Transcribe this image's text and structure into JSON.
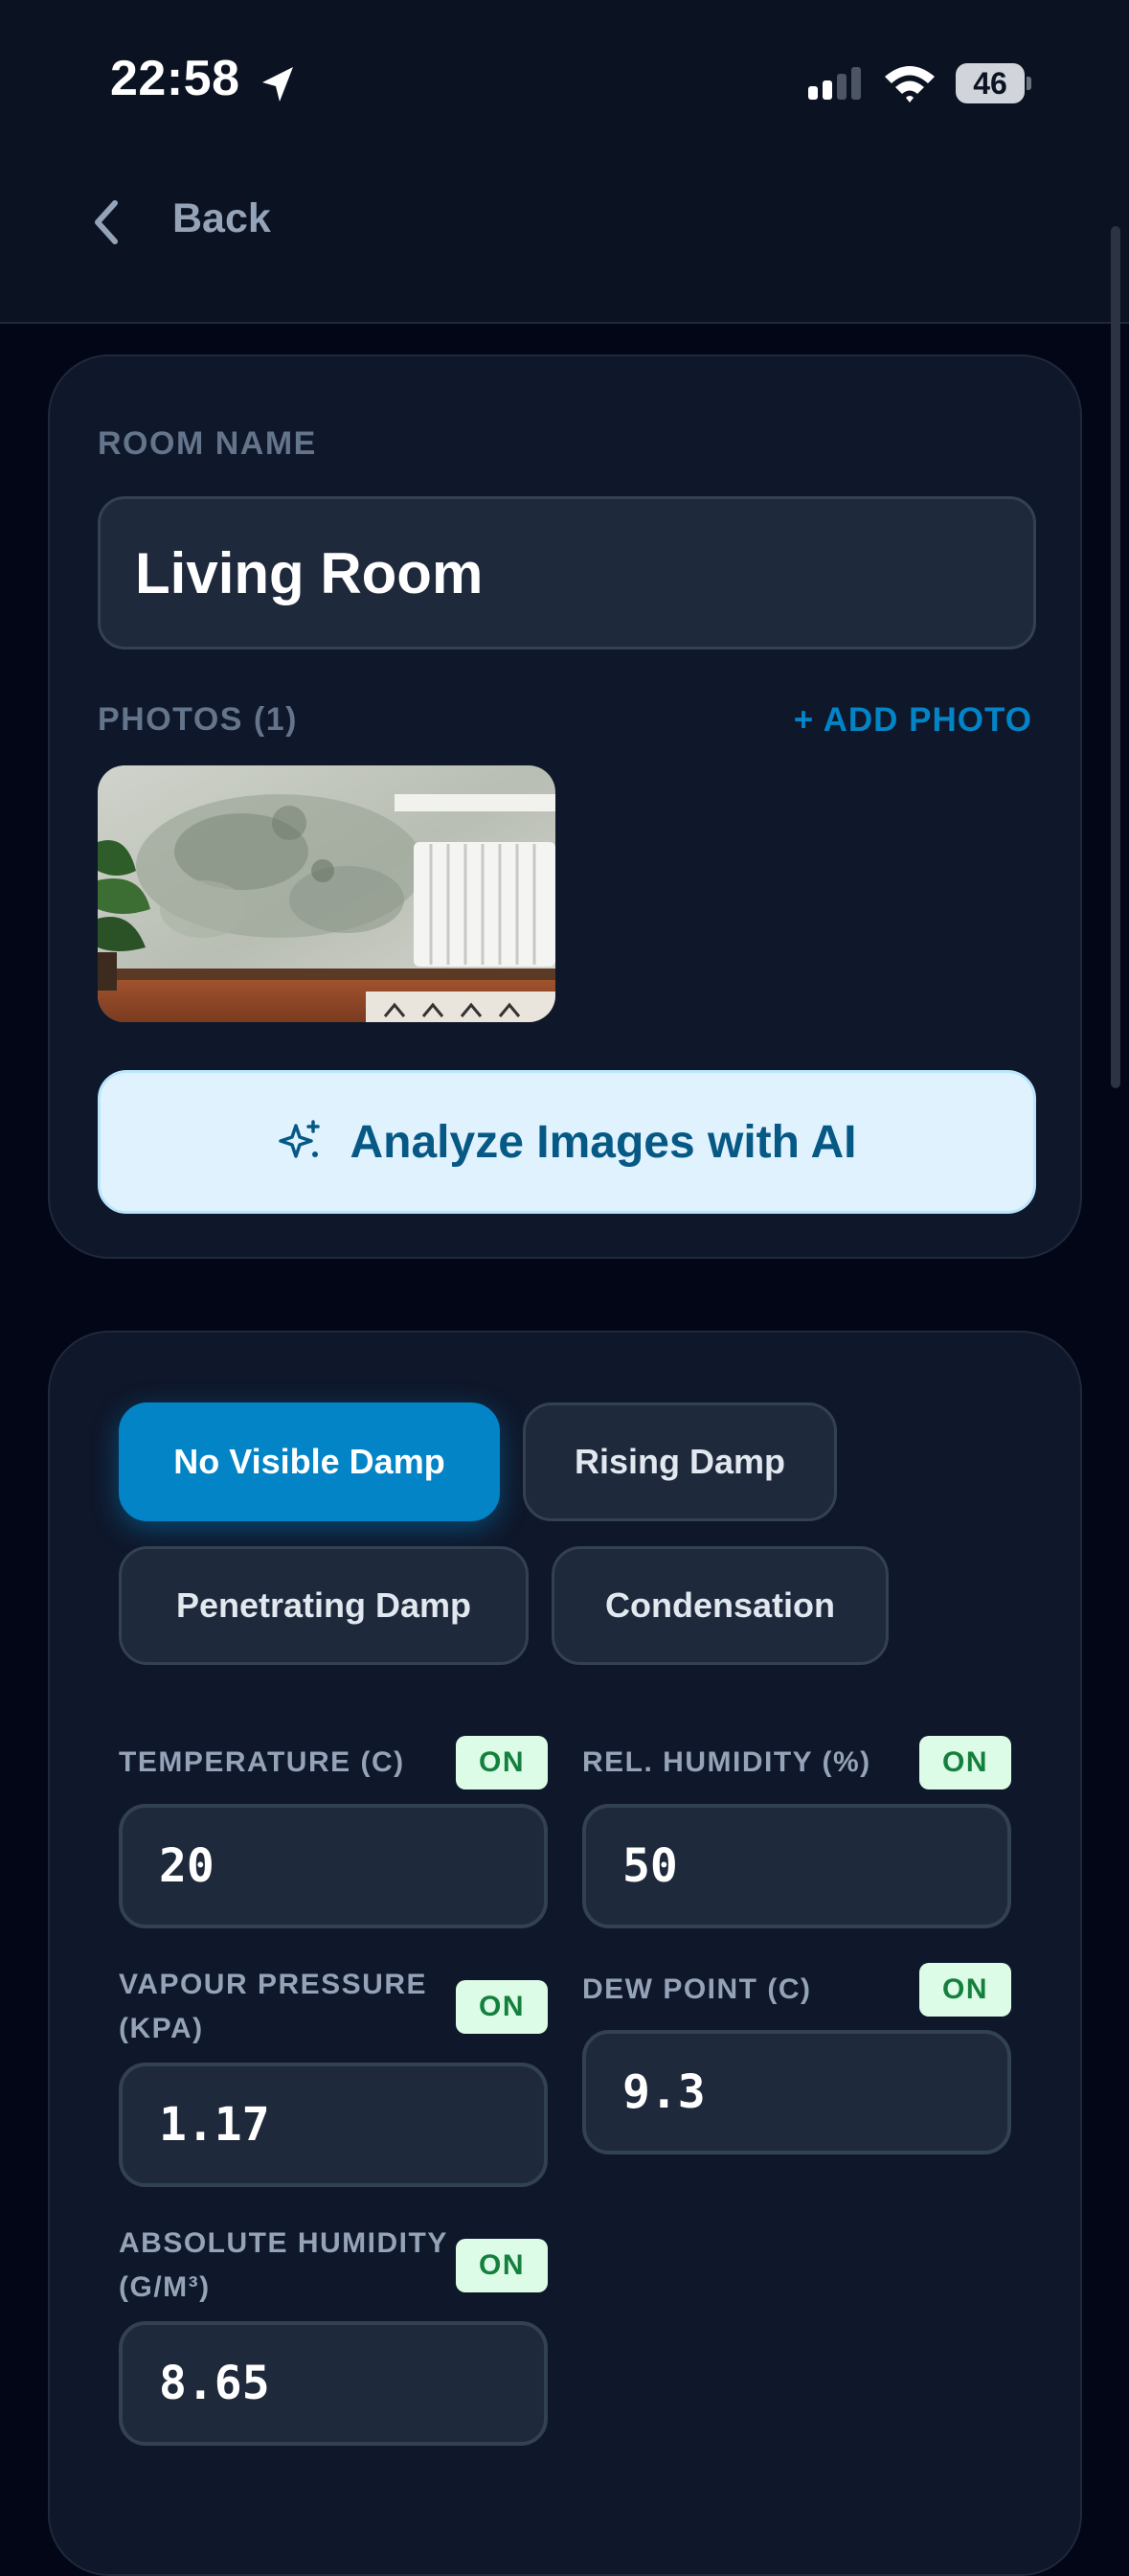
{
  "status_bar": {
    "time": "22:58",
    "battery": "46"
  },
  "nav": {
    "back_label": "Back"
  },
  "room": {
    "name_label": "ROOM NAME",
    "name_value": "Living Room",
    "photos_label": "PHOTOS (1)",
    "add_photo_label": "+ ADD PHOTO",
    "analyze_label": "Analyze Images with AI"
  },
  "damp": {
    "options": [
      "No Visible Damp",
      "Rising Damp",
      "Penetrating Damp",
      "Condensation"
    ],
    "selected": "No Visible Damp"
  },
  "readings": {
    "on_label": "ON",
    "temperature": {
      "label": "TEMPERATURE (C)",
      "value": "20"
    },
    "humidity": {
      "label": "REL. HUMIDITY (%)",
      "value": "50"
    },
    "vapour_pressure": {
      "label_line1": "VAPOUR PRESSURE",
      "label_line2": "(KPA)",
      "value": "1.17"
    },
    "dew_point": {
      "label": "DEW POINT (C)",
      "value": "9.3"
    },
    "absolute_humidity": {
      "label_line1": "ABSOLUTE HUMIDITY",
      "label_line2": "(G/M³)",
      "value": "8.65"
    }
  },
  "colors": {
    "background": "#020617",
    "card": "#0f172a",
    "accent": "#0284c7",
    "on_badge_bg": "#dcfce7",
    "on_badge_text": "#15803d"
  },
  "icons": [
    "location-arrow-icon",
    "signal-icon",
    "wifi-icon",
    "battery-icon",
    "chevron-left-icon",
    "sparkles-icon"
  ]
}
